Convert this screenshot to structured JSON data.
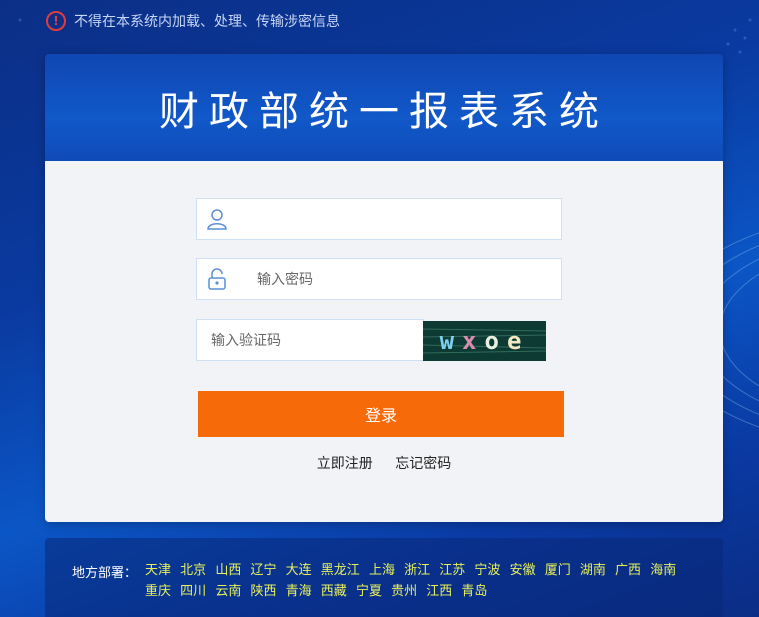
{
  "warning": {
    "text": "不得在本系统内加载、处理、传输涉密信息"
  },
  "header": {
    "title": "财政部统一报表系统"
  },
  "form": {
    "username_placeholder": "",
    "password_placeholder": "输入密码",
    "captcha_placeholder": "输入验证码",
    "captcha_text": "wxoe",
    "login_label": "登录",
    "register_label": "立即注册",
    "forgot_label": "忘记密码"
  },
  "footer": {
    "label": "地方部署：",
    "regions": [
      "天津",
      "北京",
      "山西",
      "辽宁",
      "大连",
      "黑龙江",
      "上海",
      "浙江",
      "江苏",
      "宁波",
      "安徽",
      "厦门",
      "湖南",
      "广西",
      "海南",
      "重庆",
      "四川",
      "云南",
      "陕西",
      "青海",
      "西藏",
      "宁夏",
      "贵州",
      "江西",
      "青岛"
    ]
  },
  "colors": {
    "accent_orange": "#f76a0a",
    "region_link": "#e7f05a",
    "warning_red": "#e23b3b"
  }
}
